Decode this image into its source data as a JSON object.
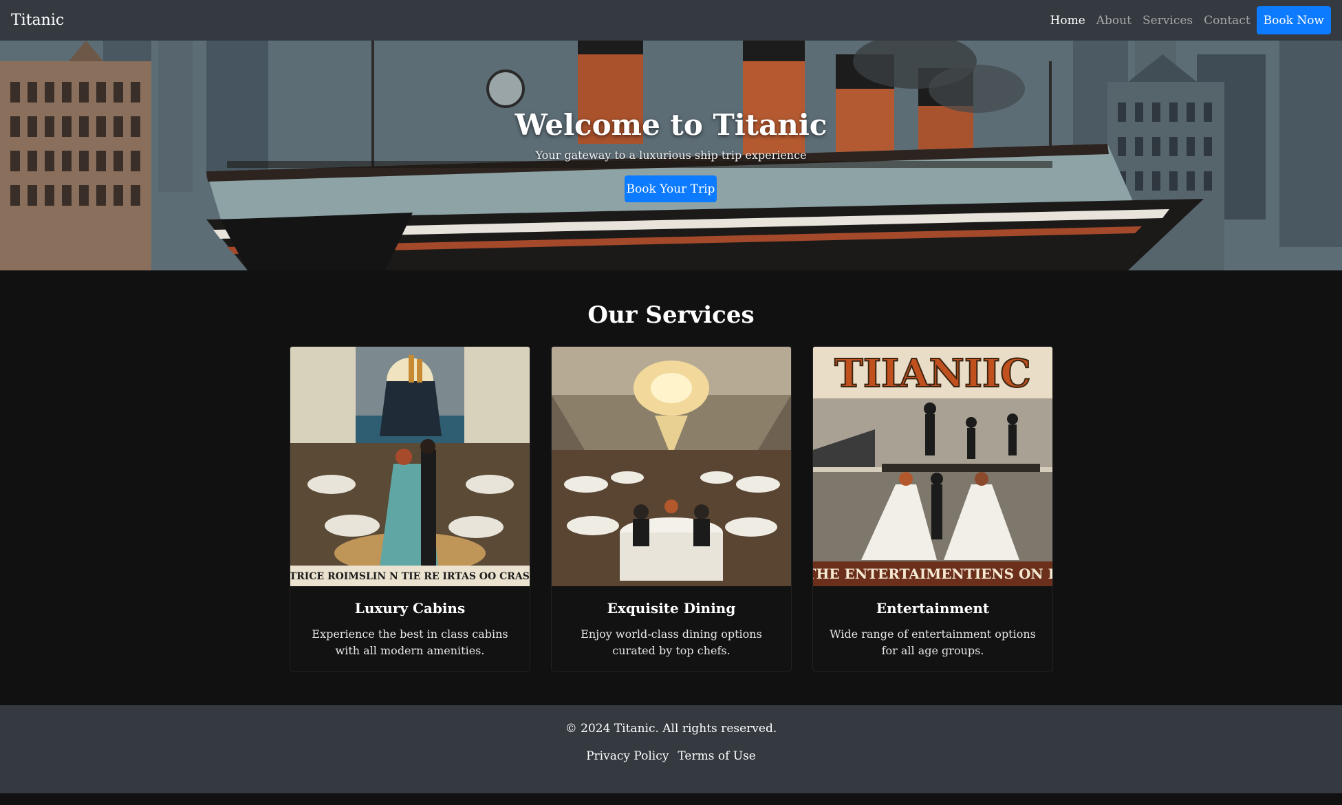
{
  "navbar": {
    "brand": "Titanic",
    "links": [
      "Home",
      "About",
      "Services",
      "Contact"
    ],
    "active": "Home",
    "cta": "Book Now"
  },
  "hero": {
    "title": "Welcome to Titanic",
    "subtitle": "Your gateway to a luxurious ship trip experience",
    "button": "Book Your Trip"
  },
  "services": {
    "heading": "Our Services",
    "cards": [
      {
        "title": "Luxury Cabins",
        "text": "Experience the best in class cabins with all modern amenities.",
        "image_banner": "TTRICE ROIMSLIN N TIE RE IRTAS OO CRAS I"
      },
      {
        "title": "Exquisite Dining",
        "text": "Enjoy world-class dining options curated by top chefs."
      },
      {
        "title": "Entertainment",
        "text": "Wide range of entertainment options for all age groups.",
        "image_title": "TIIANIIC",
        "image_banner": "E THE ENTERTAIMENTIENS ON LAI"
      }
    ]
  },
  "footer": {
    "copyright": "© 2024 Titanic. All rights reserved.",
    "links": [
      "Privacy Policy",
      "Terms of Use"
    ]
  },
  "colors": {
    "navbar_bg": "#343a40",
    "page_bg": "#111111",
    "primary": "#0d7bff"
  }
}
